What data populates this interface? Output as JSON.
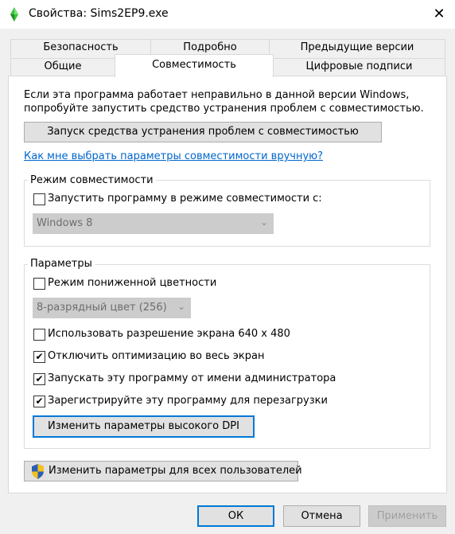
{
  "window": {
    "title": "Свойства: Sims2EP9.exe",
    "close_glyph": "✕",
    "app_icon": "sims-diamond-icon"
  },
  "tabs": {
    "row1": [
      "Безопасность",
      "Подробно",
      "Предыдущие версии"
    ],
    "row2": [
      "Общие",
      "Совместимость",
      "Цифровые подписи"
    ],
    "active": "Совместимость"
  },
  "intro": {
    "line1": "Если эта программа работает неправильно в данной версии Windows,",
    "line2": "попробуйте запустить средство устранения проблем с совместимостью."
  },
  "troubleshooter_button": "Запуск средства устранения проблем с совместимостью",
  "manual_link": "Как мне выбрать параметры совместимости вручную?",
  "compat_mode": {
    "legend": "Режим совместимости",
    "checkbox_label": "Запустить программу в режиме совместимости с:",
    "checked": false,
    "os_value": "Windows 8"
  },
  "settings": {
    "legend": "Параметры",
    "reduced_color": {
      "label": "Режим пониженной цветности",
      "checked": false
    },
    "color_value": "8-разрядный цвет (256)",
    "resolution": {
      "label": "Использовать разрешение экрана 640 x 480",
      "checked": false
    },
    "fullscreen_opt": {
      "label": "Отключить оптимизацию во весь экран",
      "checked": true
    },
    "run_admin": {
      "label": "Запускать эту программу от имени администратора",
      "checked": true
    },
    "register_restart": {
      "label": "Зарегистрируйте эту программу для перезагрузки",
      "checked": true
    },
    "dpi_button": "Изменить параметры высокого DPI"
  },
  "all_users_button": "Изменить параметры для всех пользователей",
  "footer": {
    "ok": "ОК",
    "cancel": "Отмена",
    "apply": "Применить"
  },
  "check_glyph": "✔",
  "colors": {
    "accent": "#0078d7",
    "link": "#0066cc",
    "shield_blue": "#2b5fb4",
    "shield_yellow": "#f2c21b"
  }
}
